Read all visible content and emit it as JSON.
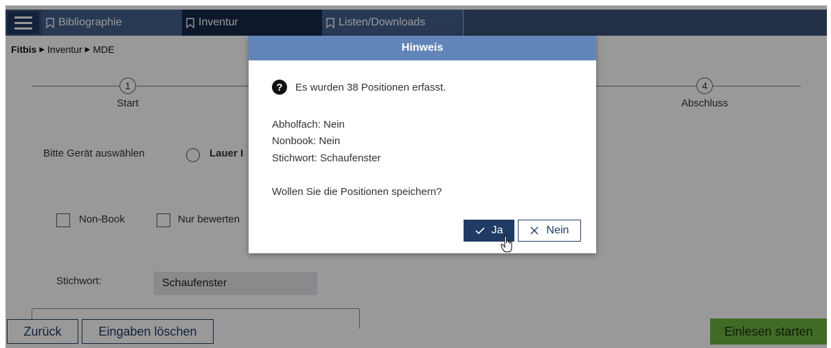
{
  "nav": {
    "tabs": [
      {
        "label": "Bibliographie",
        "icon": "bookmark-icon"
      },
      {
        "label": "Inventur",
        "icon": "bookmark-icon"
      },
      {
        "label": "Listen/Downloads",
        "icon": "bookmark-icon"
      }
    ],
    "menu_icon": "hamburger-icon"
  },
  "breadcrumb": {
    "root": "Fitbis",
    "level1": "Inventur",
    "level2": "MDE"
  },
  "stepper": {
    "steps": [
      {
        "number": "1",
        "label": "Start"
      },
      {
        "number": "4",
        "label": "Abschluss"
      }
    ]
  },
  "form": {
    "device_label": "Bitte Gerät auswählen",
    "device_option": "Lauer I",
    "nonbook_label": "Non-Book",
    "nur_bewerten_label": "Nur bewerten",
    "stichwort_label": "Stichwort:",
    "stichwort_value": "Schaufenster"
  },
  "footer": {
    "back_label": "Zurück",
    "clear_label": "Eingaben löschen",
    "start_label": "Einlesen starten"
  },
  "dialog": {
    "title": "Hinweis",
    "message": "Es wurden 38 Positionen erfasst.",
    "abholfach": "Abholfach: Nein",
    "nonbook": "Nonbook: Nein",
    "stichwort": "Stichwort: Schaufenster",
    "question": "Wollen Sie die Positionen speichern?",
    "yes_label": "Ja",
    "no_label": "Nein"
  },
  "colors": {
    "nav_bg": "#3b5275",
    "nav_active": "#16284a",
    "dialog_header": "#6285b9",
    "primary": "#1f3a63",
    "success": "#6cb33e"
  }
}
